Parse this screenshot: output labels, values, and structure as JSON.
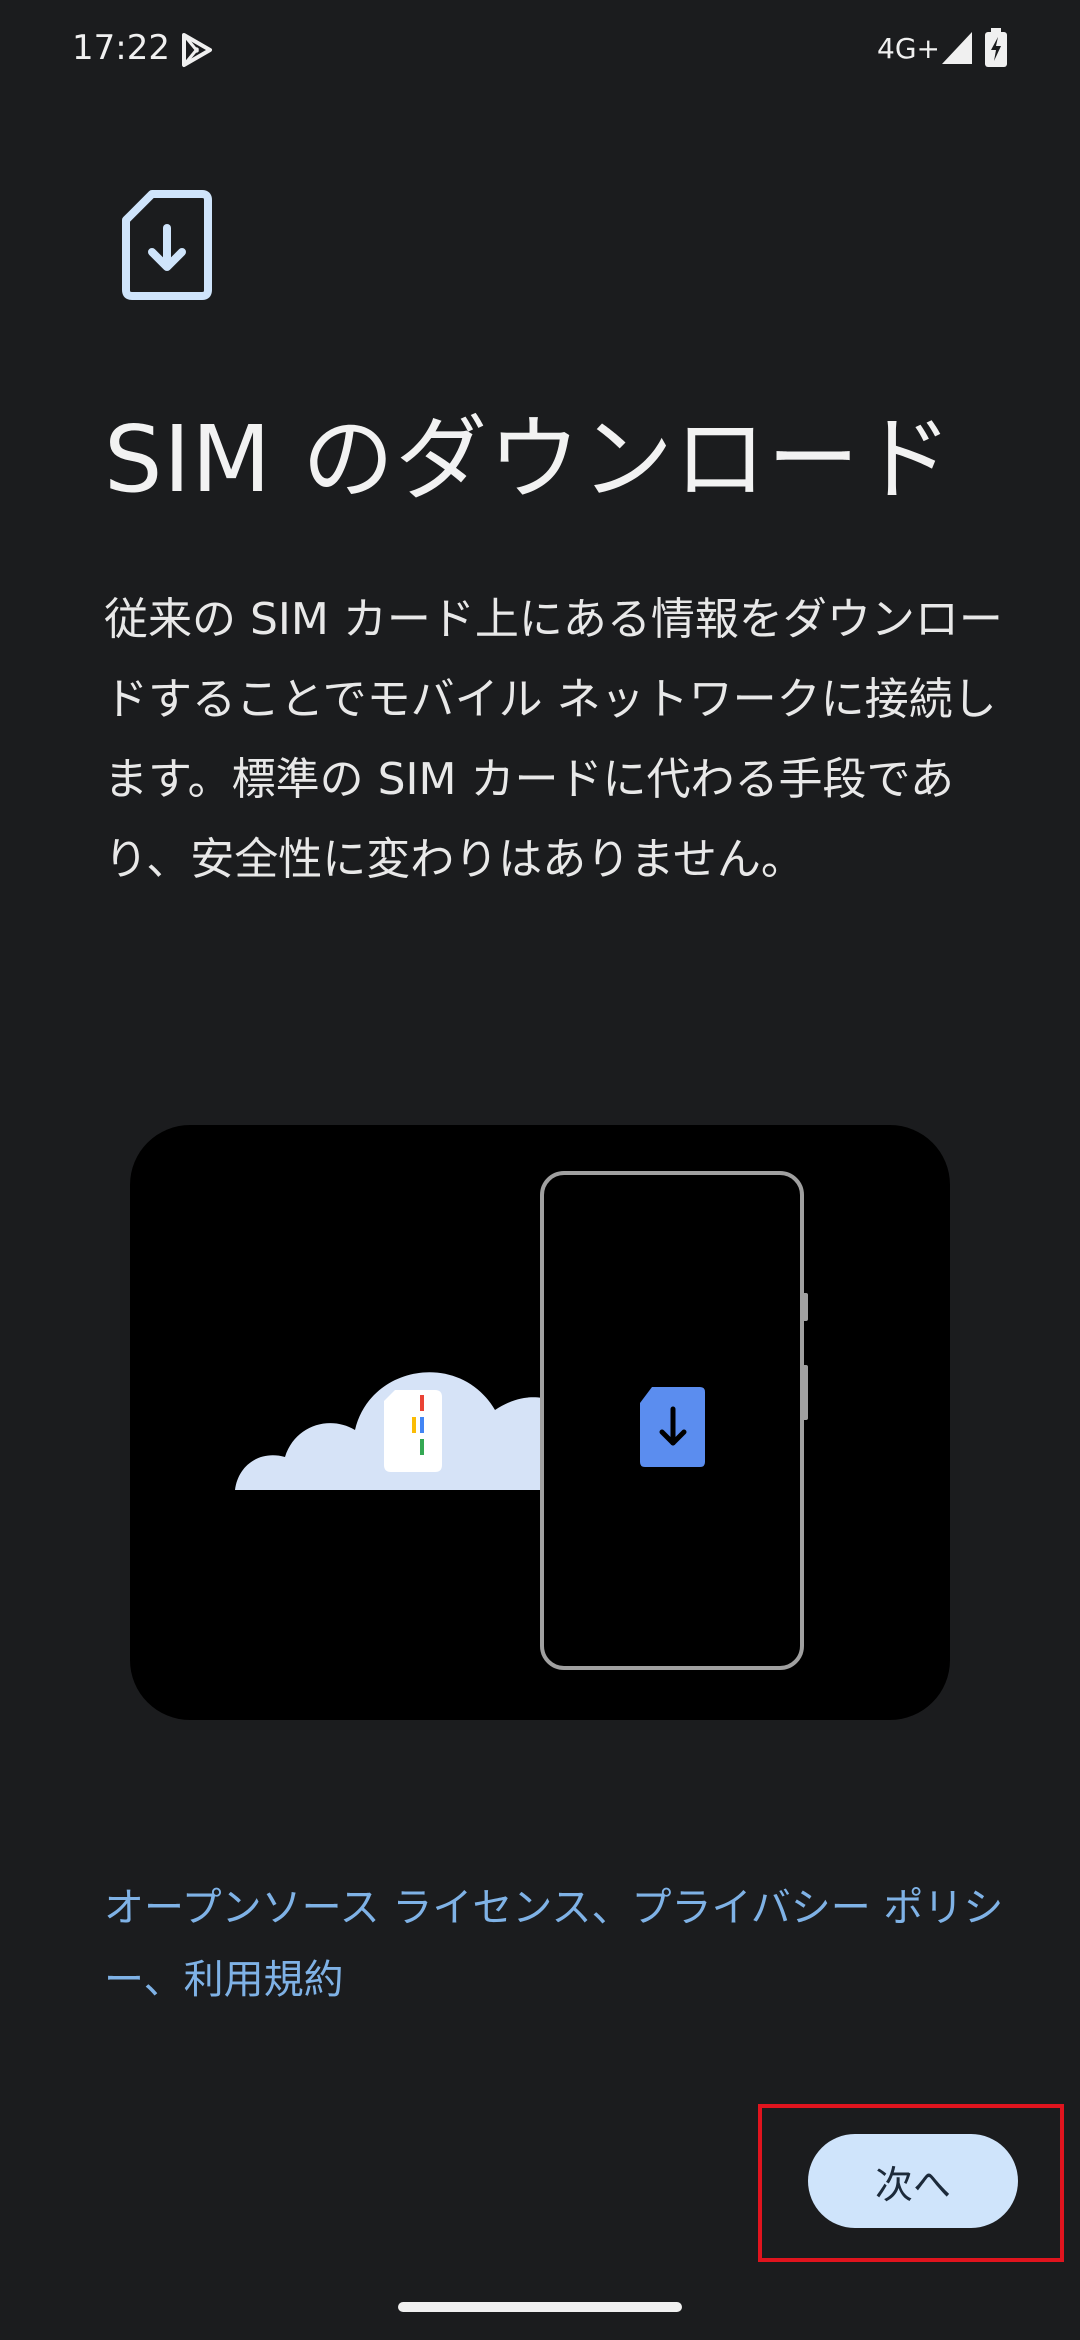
{
  "status_bar": {
    "time": "17:22",
    "network": "4G+",
    "icons": [
      "play-icon",
      "signal-icon",
      "battery-charging-icon"
    ]
  },
  "header_icon": "sim-download-icon",
  "title": "SIM のダウンロード",
  "description": "従来の SIM カード上にある情報をダウンロードすることでモバイル ネットワークに接続します。標準の SIM カードに代わる手段であり、安全性に変わりはありません。",
  "illustration": {
    "icons": [
      "cloud-icon",
      "sim-card-icon",
      "phone-icon",
      "sim-download-icon"
    ]
  },
  "legal": {
    "open_source": "オープンソース ライセンス",
    "separator1": "、",
    "privacy": "プライバシー ポリシー",
    "separator2": "、",
    "terms": "利用規約"
  },
  "next_button": "次へ",
  "colors": {
    "background": "#1b1c1e",
    "link": "#7fb2e6",
    "button": "#cfe4fb",
    "highlight": "#e0141e",
    "sim_icon_blue": "#5b8def"
  }
}
